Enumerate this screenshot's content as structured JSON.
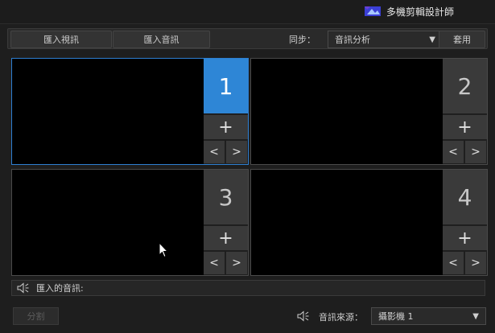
{
  "app": {
    "title": "多機剪輯設計師",
    "logo_icon": "multicam-logo-icon"
  },
  "toolbar": {
    "import_video_label": "匯入視訊",
    "import_audio_label": "匯入音訊",
    "sync_label": "同步：",
    "sync_value": "音訊分析",
    "sync_arrow": "▼",
    "apply_label": "套用"
  },
  "panels": [
    {
      "number": "1",
      "active": true
    },
    {
      "number": "2",
      "active": false
    },
    {
      "number": "3",
      "active": false
    },
    {
      "number": "4",
      "active": false
    }
  ],
  "panel_controls": {
    "add_glyph": "+",
    "prev_glyph": "<",
    "next_glyph": ">"
  },
  "audio_bar": {
    "label": "匯入的音訊:"
  },
  "bottom": {
    "split_label": "分割",
    "source_label": "音訊來源：",
    "source_value": "攝影機 1",
    "source_arrow": "▼"
  },
  "colors": {
    "accent": "#2e86d6",
    "background": "#1e1e1e",
    "panel_border_active": "#2e7fd1"
  }
}
